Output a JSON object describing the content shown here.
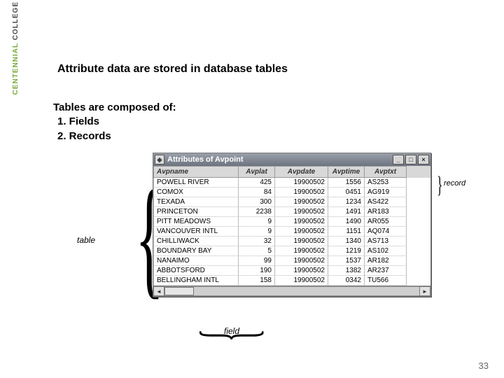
{
  "logo": {
    "top": "COLLEGE",
    "bottom": "CENTENNIAL"
  },
  "heading": "Attribute data are stored in database tables",
  "intro": "Tables are composed of:",
  "bullet1": "1. Fields",
  "bullet2": "2. Records",
  "labels": {
    "table": "table",
    "field": "field",
    "record": "record"
  },
  "window": {
    "icon_glyph": "◈",
    "title": "Attributes of Avpoint",
    "min": "_",
    "max": "□",
    "close": "×",
    "scroll_left": "◄",
    "scroll_right": "►"
  },
  "columns": [
    "Avpname",
    "Avplat",
    "Avpdate",
    "Avptime",
    "Avptxt"
  ],
  "rows": [
    {
      "c0": "POWELL RIVER",
      "c1": "425",
      "c2": "19900502",
      "c3": "1556",
      "c4": "AS253"
    },
    {
      "c0": "COMOX",
      "c1": "84",
      "c2": "19900502",
      "c3": "0451",
      "c4": "AG919"
    },
    {
      "c0": "TEXADA",
      "c1": "300",
      "c2": "19900502",
      "c3": "1234",
      "c4": "AS422"
    },
    {
      "c0": "PRINCETON",
      "c1": "2238",
      "c2": "19900502",
      "c3": "1491",
      "c4": "AR183"
    },
    {
      "c0": "PITT MEADOWS",
      "c1": "9",
      "c2": "19900502",
      "c3": "1490",
      "c4": "AR055"
    },
    {
      "c0": "VANCOUVER INTL",
      "c1": "9",
      "c2": "19900502",
      "c3": "1151",
      "c4": "AQ074"
    },
    {
      "c0": "CHILLIWACK",
      "c1": "32",
      "c2": "19900502",
      "c3": "1340",
      "c4": "AS713"
    },
    {
      "c0": "BOUNDARY BAY",
      "c1": "5",
      "c2": "19900502",
      "c3": "1219",
      "c4": "AS102"
    },
    {
      "c0": "NANAIMO",
      "c1": "99",
      "c2": "19900502",
      "c3": "1537",
      "c4": "AR182"
    },
    {
      "c0": "ABBOTSFORD",
      "c1": "190",
      "c2": "19900502",
      "c3": "1382",
      "c4": "AR237"
    },
    {
      "c0": "BELLINGHAM INTL",
      "c1": "158",
      "c2": "19900502",
      "c3": "0342",
      "c4": "TU566"
    }
  ],
  "pagenum": "33"
}
